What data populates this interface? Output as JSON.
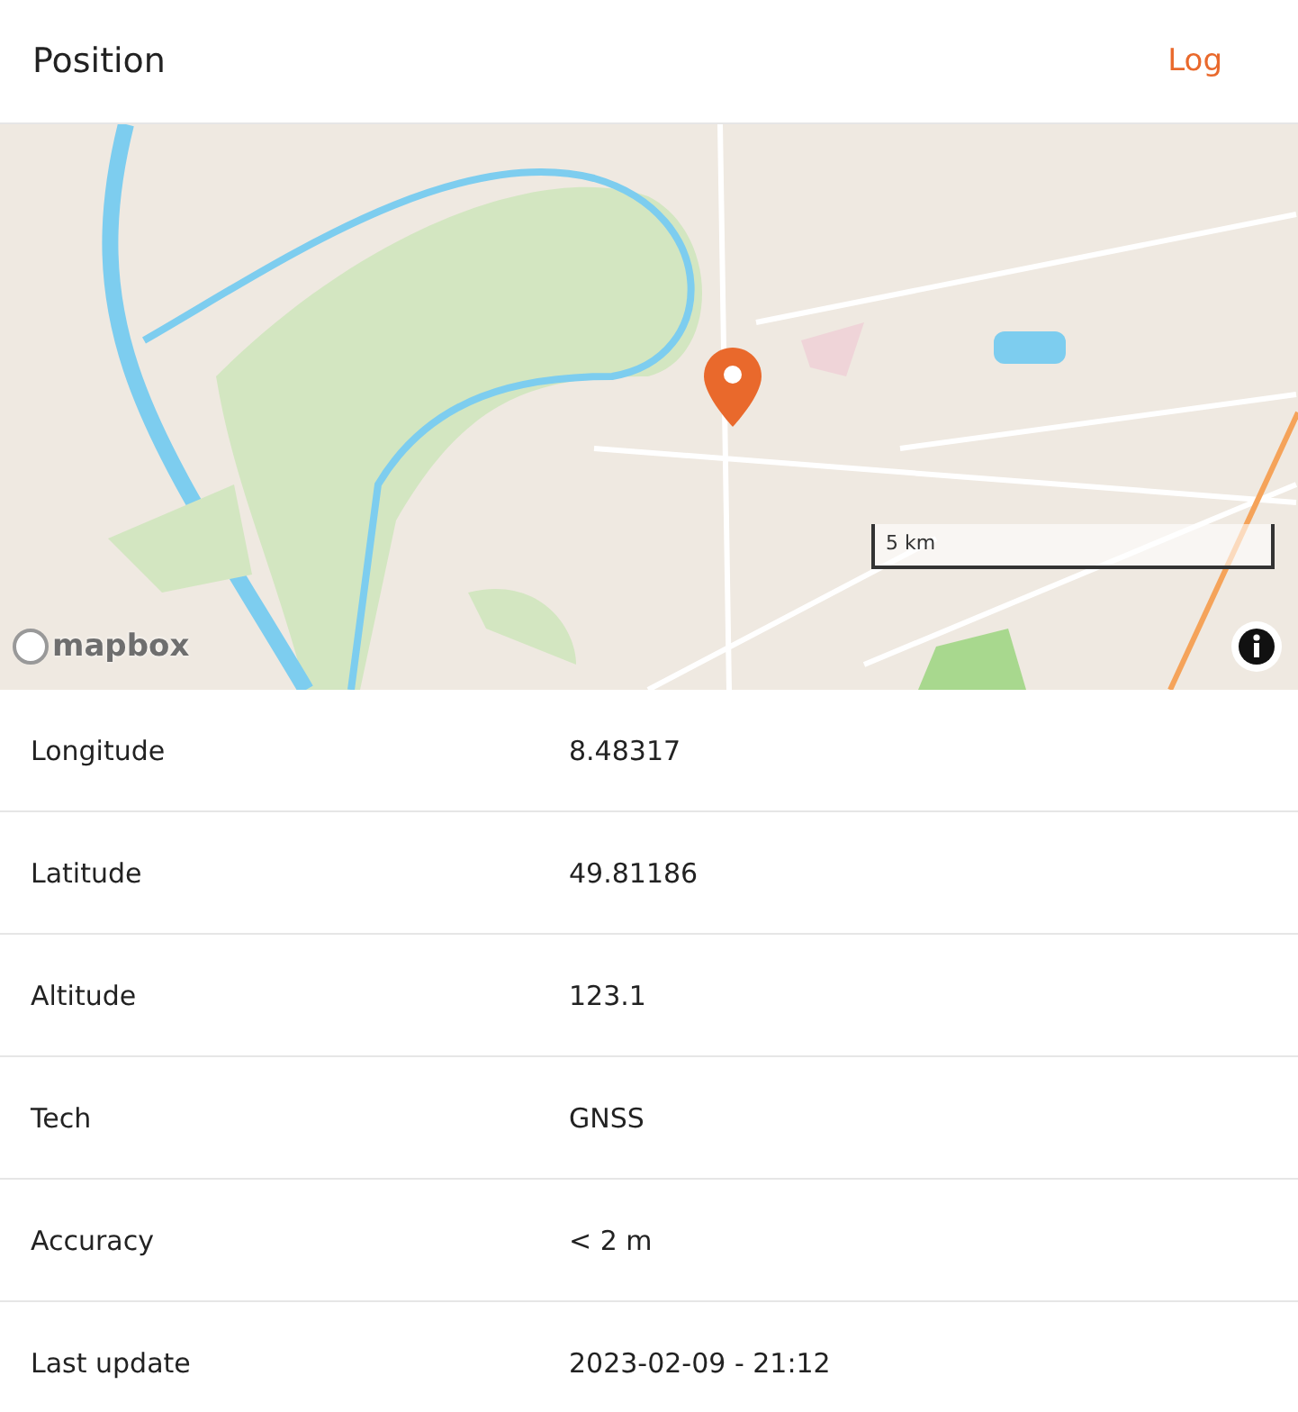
{
  "header": {
    "title": "Position",
    "action": "Log"
  },
  "map": {
    "scale": "5 km",
    "attribution": "mapbox"
  },
  "fields": [
    {
      "label": "Longitude",
      "value": "8.48317"
    },
    {
      "label": "Latitude",
      "value": "49.81186"
    },
    {
      "label": "Altitude",
      "value": "123.1"
    },
    {
      "label": "Tech",
      "value": "GNSS"
    },
    {
      "label": "Accuracy",
      "value": "< 2 m"
    },
    {
      "label": "Last update",
      "value": "2023-02-09 - 21:12"
    }
  ]
}
